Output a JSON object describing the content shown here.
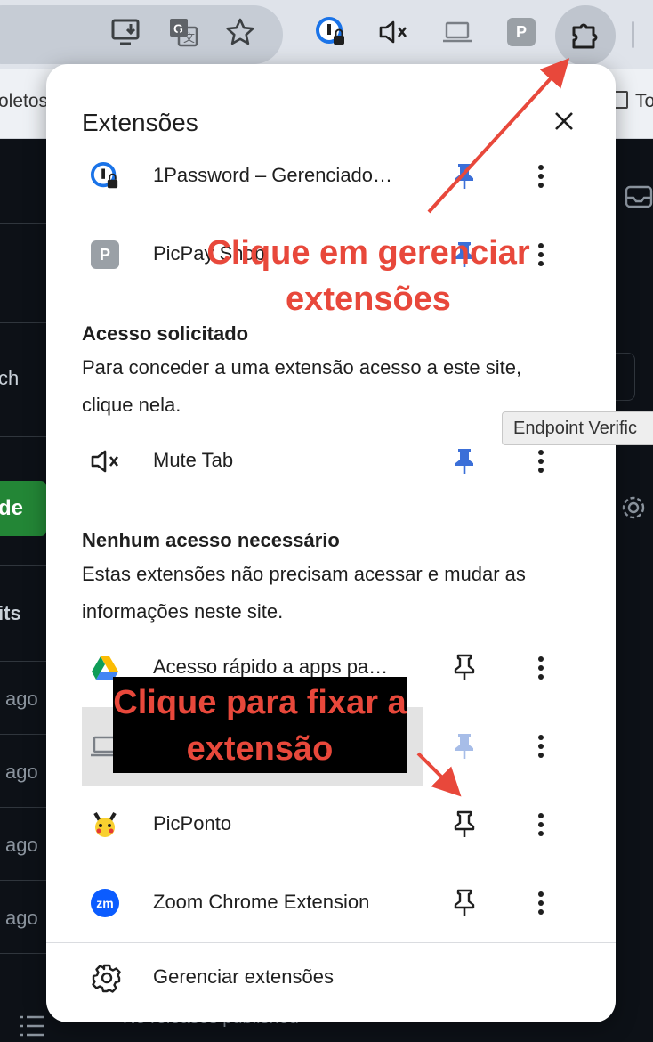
{
  "bookmarks": {
    "left_text": "oletos",
    "right_text": "To"
  },
  "page_behind": {
    "labels": [
      "ch",
      "de",
      "its",
      "ago",
      "ago",
      "ago",
      "ago"
    ],
    "footer_text": "No releases published"
  },
  "tooltip": {
    "text": "Endpoint Verific"
  },
  "popup": {
    "title": "Extensões",
    "pinned": [
      {
        "name": "1Password – Gerenciado…",
        "icon": "onepassword-icon",
        "pinned": true
      },
      {
        "name": "PicPay Shop",
        "icon": "picpay-icon",
        "pinned": true
      }
    ],
    "access_requested": {
      "heading": "Acesso solicitado",
      "description": "Para conceder a uma extensão acesso a este site, clique nela.",
      "items": [
        {
          "name": "Mute Tab",
          "icon": "mute-icon",
          "pinned": true
        }
      ]
    },
    "no_access": {
      "heading": "Nenhum acesso necessário",
      "description": "Estas extensões não precisam acessar e mudar as informações neste site.",
      "items": [
        {
          "name": "Acesso rápido a apps pa…",
          "icon": "google-drive-icon",
          "pinned": false
        },
        {
          "name": "",
          "icon": "laptop-icon",
          "pinned": true
        },
        {
          "name": "PicPonto",
          "icon": "pikachu-icon",
          "pinned": false
        },
        {
          "name": "Zoom Chrome Extension",
          "icon": "zoom-icon",
          "pinned": false
        }
      ]
    },
    "manage_label": "Gerenciar extensões"
  },
  "annotations": {
    "top": "Clique em gerenciar extensões",
    "bottom": "Clique para fixar a extensão"
  },
  "colors": {
    "accent_pin": "#3b6fd8",
    "annotation": "#e8483b",
    "zoom_blue": "#0b5cff"
  }
}
